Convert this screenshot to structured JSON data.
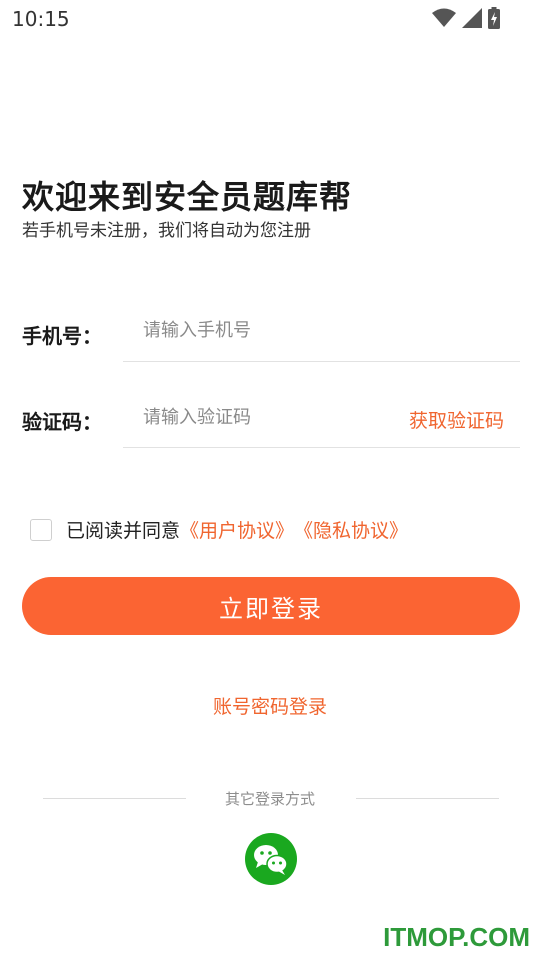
{
  "status_bar": {
    "time": "10:15",
    "icons": [
      "wifi-icon",
      "signal-icon",
      "battery-charging-icon"
    ]
  },
  "header": {
    "title": "欢迎来到安全员题库帮",
    "subtitle": "若手机号未注册，我们将自动为您注册"
  },
  "form": {
    "phone": {
      "label": "手机号：",
      "placeholder": "请输入手机号",
      "value": ""
    },
    "code": {
      "label": "验证码：",
      "placeholder": "请输入验证码",
      "value": "",
      "get_code_label": "获取验证码"
    }
  },
  "agreement": {
    "checked": false,
    "prefix": "已阅读并同意",
    "user_agreement": "《用户协议》",
    "privacy_policy": "《隐私协议》"
  },
  "actions": {
    "login_label": "立即登录",
    "password_login_label": "账号密码登录"
  },
  "other_login": {
    "title": "其它登录方式",
    "methods": [
      "wechat-icon"
    ]
  },
  "watermark": "ITMOP.COM",
  "colors": {
    "accent": "#fb6433",
    "link": "#f0652f",
    "wechat": "#1aa81f",
    "watermark": "#2e9a3a"
  }
}
